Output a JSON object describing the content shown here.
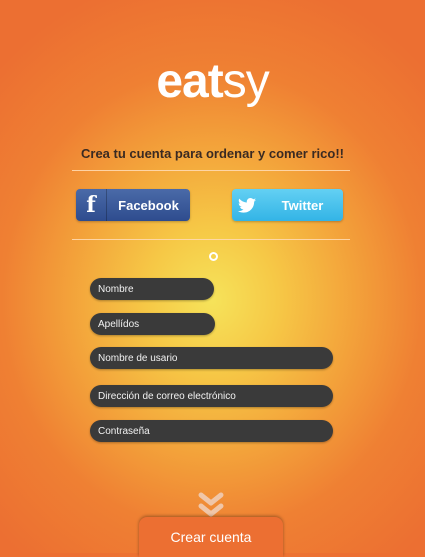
{
  "app": {
    "logo_bold": "eat",
    "logo_light": "sy"
  },
  "headline": "Crea tu cuenta para ordenar y comer rico!!",
  "social": {
    "facebook": {
      "icon": "f",
      "label": "Facebook"
    },
    "twitter": {
      "icon": "bird",
      "label": "Twitter"
    }
  },
  "divider_label": "o",
  "form": {
    "nombre": "Nombre",
    "apellidos": "Apellídos",
    "usuario": "Nombre de usario",
    "correo": "Dirección de correo electrónico",
    "contrasena": "Contraseña"
  },
  "create_button": "Crear cuenta",
  "colors": {
    "accent": "#ec6f32",
    "center": "#f6e35a",
    "field": "#3a3a3a",
    "facebook": "#3b5998",
    "twitter": "#3fbdea"
  }
}
